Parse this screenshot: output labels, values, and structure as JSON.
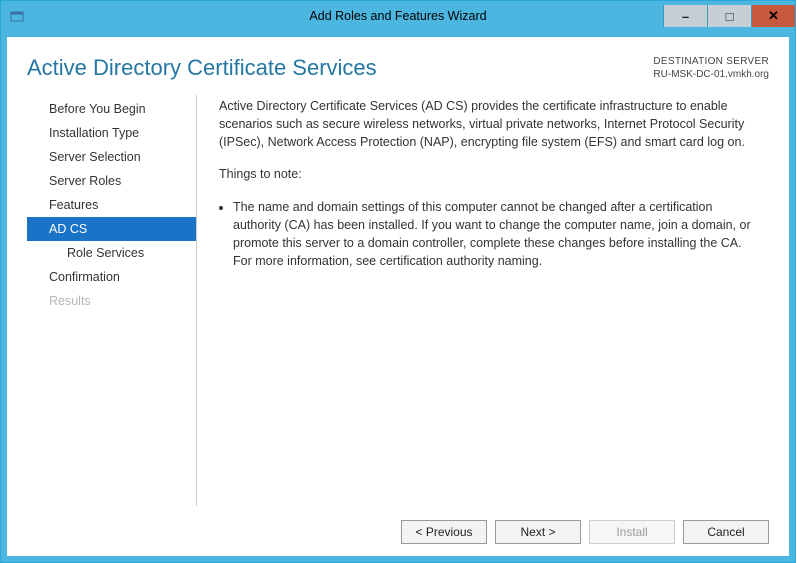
{
  "window": {
    "title": "Add Roles and Features Wizard",
    "buttons": {
      "minimize": "–",
      "maximize": "□",
      "close": "✕"
    }
  },
  "header": {
    "page_title": "Active Directory Certificate Services",
    "destination_label": "DESTINATION SERVER",
    "destination_value": "RU-MSK-DC-01.vmkh.org"
  },
  "sidebar": {
    "items": [
      {
        "label": "Before You Begin",
        "sub": false,
        "active": false,
        "disabled": false
      },
      {
        "label": "Installation Type",
        "sub": false,
        "active": false,
        "disabled": false
      },
      {
        "label": "Server Selection",
        "sub": false,
        "active": false,
        "disabled": false
      },
      {
        "label": "Server Roles",
        "sub": false,
        "active": false,
        "disabled": false
      },
      {
        "label": "Features",
        "sub": false,
        "active": false,
        "disabled": false
      },
      {
        "label": "AD CS",
        "sub": false,
        "active": true,
        "disabled": false
      },
      {
        "label": "Role Services",
        "sub": true,
        "active": false,
        "disabled": false
      },
      {
        "label": "Confirmation",
        "sub": false,
        "active": false,
        "disabled": false
      },
      {
        "label": "Results",
        "sub": false,
        "active": false,
        "disabled": true
      }
    ]
  },
  "main": {
    "intro": "Active Directory Certificate Services (AD CS) provides the certificate infrastructure to enable scenarios such as secure wireless networks, virtual private networks, Internet Protocol Security (IPSec), Network Access Protection (NAP), encrypting file system (EFS) and smart card log on.",
    "note_heading": "Things to note:",
    "bullets": [
      "The name and domain settings of this computer cannot be changed after a certification authority (CA) has been installed. If you want to change the computer name, join a domain, or promote this server to a domain controller, complete these changes before installing the CA. For more information, see certification authority naming."
    ]
  },
  "footer": {
    "previous": "< Previous",
    "next": "Next >",
    "install": "Install",
    "cancel": "Cancel"
  }
}
